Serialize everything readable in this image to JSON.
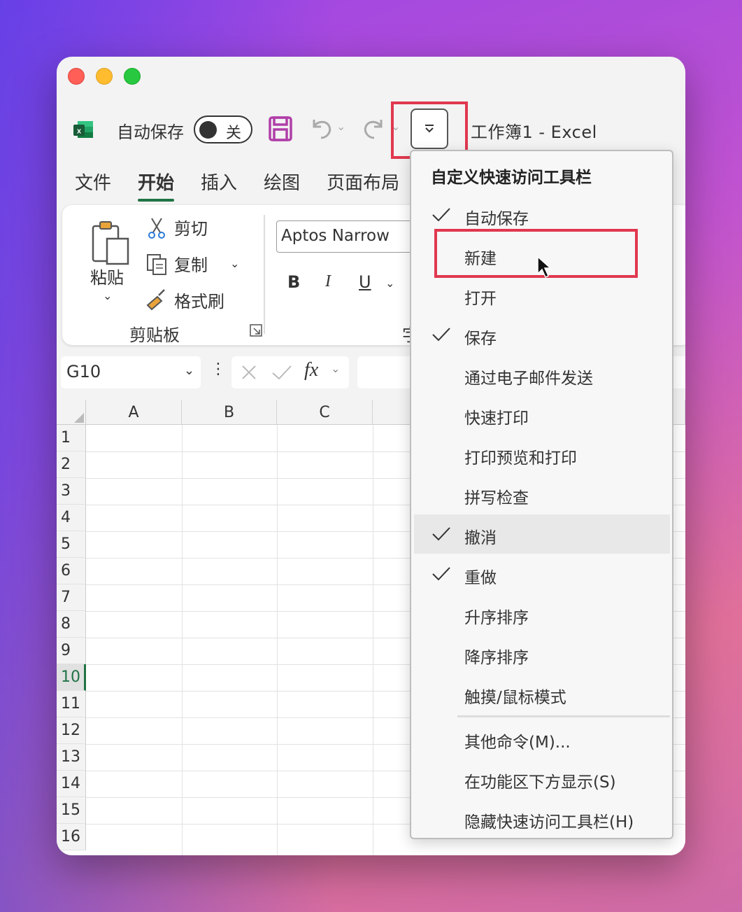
{
  "window": {
    "app_title": "工作簿1  -  Excel"
  },
  "qat": {
    "autosave_label": "自动保存",
    "toggle_state": "关",
    "icons": [
      "excel-logo",
      "save-icon",
      "undo-icon",
      "redo-icon",
      "customize-qat-icon"
    ]
  },
  "ribbon_tabs": [
    {
      "label": "文件",
      "active": false
    },
    {
      "label": "开始",
      "active": true
    },
    {
      "label": "插入",
      "active": false
    },
    {
      "label": "绘图",
      "active": false
    },
    {
      "label": "页面布局",
      "active": false
    }
  ],
  "ribbon": {
    "paste_label": "粘贴",
    "cut_label": "剪切",
    "copy_label": "复制",
    "format_painter_label": "格式刷",
    "clipboard_group_label": "剪贴板",
    "font_name": "Aptos Narrow",
    "bold": "B",
    "italic": "I",
    "underline": "U",
    "font_group_label_partial": "字"
  },
  "formula_bar": {
    "name_box": "G10",
    "fx": "fx"
  },
  "grid": {
    "columns": [
      "A",
      "B",
      "C"
    ],
    "rows": [
      "1",
      "2",
      "3",
      "4",
      "5",
      "6",
      "7",
      "8",
      "9",
      "10",
      "11",
      "12",
      "13",
      "14",
      "15",
      "16"
    ],
    "selected_row": "10"
  },
  "menu": {
    "header": "自定义快速访问工具栏",
    "items": [
      {
        "label": "自动保存",
        "checked": true
      },
      {
        "label": "新建",
        "checked": false
      },
      {
        "label": "打开",
        "checked": false
      },
      {
        "label": "保存",
        "checked": true
      },
      {
        "label": "通过电子邮件发送",
        "checked": false
      },
      {
        "label": "快速打印",
        "checked": false
      },
      {
        "label": "打印预览和打印",
        "checked": false
      },
      {
        "label": "拼写检查",
        "checked": false
      },
      {
        "label": "撤消",
        "checked": true
      },
      {
        "label": "重做",
        "checked": true
      },
      {
        "label": "升序排序",
        "checked": false
      },
      {
        "label": "降序排序",
        "checked": false
      },
      {
        "label": "触摸/鼠标模式",
        "checked": false
      }
    ],
    "extra_items": [
      {
        "label": "其他命令(M)..."
      },
      {
        "label": "在功能区下方显示(S)"
      },
      {
        "label": "隐藏快速访问工具栏(H)"
      }
    ]
  },
  "colors": {
    "accent_green": "#217346",
    "highlight_red": "#e0384f",
    "save_icon_purple": "#b03fa8"
  }
}
